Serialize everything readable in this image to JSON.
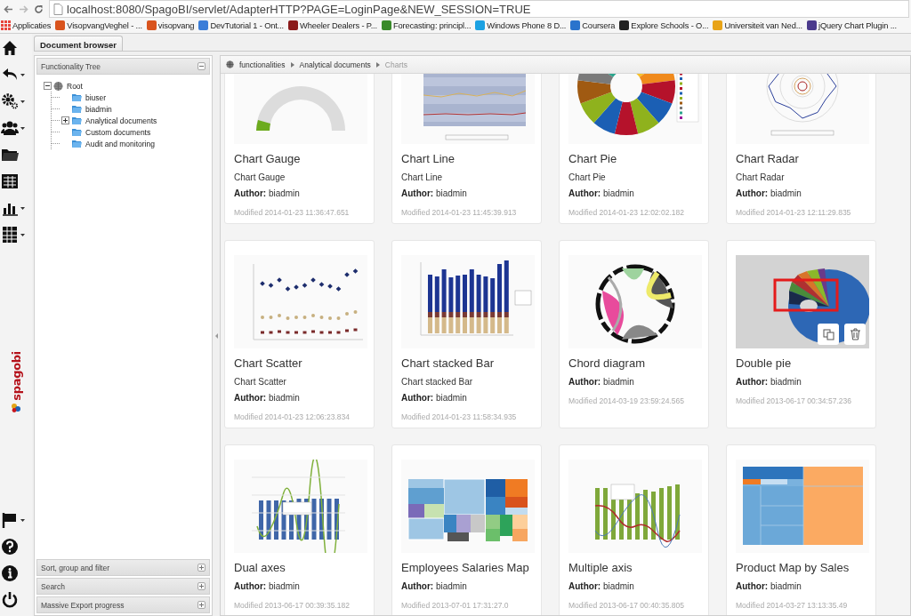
{
  "browser": {
    "url": "localhost:8080/SpagoBI/servlet/AdapterHTTP?PAGE=LoginPage&NEW_SESSION=TRUE",
    "bookmarks": [
      {
        "label": "Applicaties",
        "color": "#e8453c"
      },
      {
        "label": "VisopvangVeghel - ...",
        "color": "#d9541e"
      },
      {
        "label": "visopvang",
        "color": "#d9541e"
      },
      {
        "label": "DevTutorial 1 - Ont...",
        "color": "#3b7dd8"
      },
      {
        "label": "Wheeler Dealers - P...",
        "color": "#8b1a1a"
      },
      {
        "label": "Forecasting: principl...",
        "color": "#3a8a2a"
      },
      {
        "label": "Windows Phone 8 D...",
        "color": "#1ba1e2"
      },
      {
        "label": "Coursera",
        "color": "#2a73cc"
      },
      {
        "label": "Explore Schools - O...",
        "color": "#222222"
      },
      {
        "label": "Universiteit van Ned...",
        "color": "#e8a317"
      },
      {
        "label": "jQuery Chart Plugin ...",
        "color": "#4b3a8c"
      }
    ]
  },
  "side_nav": {
    "top": [
      {
        "dropdown": false
      },
      {
        "dropdown": true
      },
      {
        "dropdown": true
      },
      {
        "dropdown": true
      },
      {
        "dropdown": false
      },
      {
        "dropdown": false
      },
      {
        "dropdown": true
      },
      {
        "dropdown": true
      }
    ],
    "logo": "spagobi",
    "bottom": [
      {
        "dropdown": true
      },
      {
        "dropdown": false
      },
      {
        "dropdown": false
      },
      {
        "dropdown": false
      }
    ]
  },
  "tabs": [
    {
      "label": "Document browser",
      "selected": true
    }
  ],
  "functionality_tree": {
    "title": "Functionality Tree",
    "expanded": true,
    "nodes": [
      {
        "label": "Root",
        "expanded": true,
        "children": [
          {
            "label": "biuser"
          },
          {
            "label": "biadmin"
          },
          {
            "label": "Analytical documents",
            "expanded": false
          },
          {
            "label": "Custom documents"
          },
          {
            "label": "Audit and monitoring"
          }
        ]
      }
    ]
  },
  "panels": [
    {
      "title": "Sort, group and filter",
      "expanded": false
    },
    {
      "title": "Search",
      "expanded": false
    },
    {
      "title": "Massive Export progress",
      "expanded": false
    }
  ],
  "breadcrumb": [
    "functionalities",
    "Analytical documents",
    "Charts"
  ],
  "documents": [
    {
      "title": "Chart Gauge",
      "subtitle": "Chart Gauge",
      "author": "**Author:** biadmin",
      "modified": "Modified 2014-01-23 11:36:47.651",
      "kind": "gauge",
      "actions_shown": false
    },
    {
      "title": "Chart Line",
      "subtitle": "Chart Line",
      "author": "**Author:** biadmin",
      "modified": "Modified 2014-01-23 11:45:39.913",
      "kind": "line",
      "actions_shown": false
    },
    {
      "title": "Chart Pie",
      "subtitle": "Chart Pie",
      "author": "**Author:** biadmin",
      "modified": "Modified 2014-01-23 12:02:02.182",
      "kind": "pie",
      "actions_shown": false
    },
    {
      "title": "Chart Radar",
      "subtitle": "Chart Radar",
      "author": "**Author:** biadmin",
      "modified": "Modified 2014-01-23 12:11:29.835",
      "kind": "radar",
      "actions_shown": false
    },
    {
      "title": "Chart Scatter",
      "subtitle": "Chart Scatter",
      "author": "**Author:** biadmin",
      "modified": "Modified 2014-01-23 12:06:23.834",
      "kind": "scatter",
      "actions_shown": false
    },
    {
      "title": "Chart stacked Bar",
      "subtitle": "Chart stacked Bar",
      "author": "**Author:** biadmin",
      "modified": "Modified 2014-01-23 11:58:34.935",
      "kind": "stacked_bar",
      "actions_shown": false
    },
    {
      "title": "Chord diagram",
      "author": "**Author:** biadmin",
      "modified": "Modified 2014-03-19 23:59:24.565",
      "kind": "chord",
      "actions_shown": false
    },
    {
      "title": "Double pie",
      "author": "**Author:** biadmin",
      "modified": "Modified 2013-06-17 00:34:57.236",
      "kind": "double_pie",
      "actions_shown": true
    },
    {
      "title": "Dual axes",
      "author": "**Author:** biadmin",
      "modified": "Modified 2013-06-17 00:39:35.182",
      "kind": "dual_axes",
      "actions_shown": false
    },
    {
      "title": "Employees Salaries Map",
      "author": "**Author:** biadmin",
      "modified": "Modified 2013-07-01 17:31:27.0",
      "kind": "treemap",
      "actions_shown": false
    },
    {
      "title": "Multiple axis",
      "author": "**Author:** biadmin",
      "modified": "Modified 2013-06-17 00:40:35.805",
      "kind": "multiple_axis",
      "actions_shown": false
    },
    {
      "title": "Product Map by Sales",
      "author": "**Author:** biadmin",
      "modified": "Modified 2014-03-27 13:13:35.49",
      "kind": "treemap_large",
      "actions_shown": false
    }
  ]
}
